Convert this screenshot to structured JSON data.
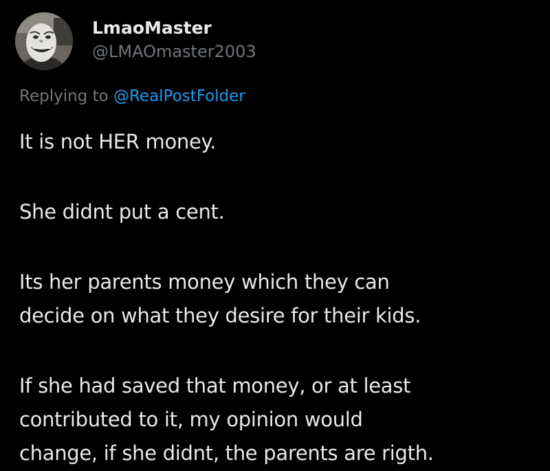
{
  "post": {
    "author": {
      "display_name": "LmaoMaster",
      "handle": "@LMAOmaster2003",
      "avatar_icon": "avatar-troll-mask-icon"
    },
    "replying": {
      "prefix": "Replying to",
      "handle": "@RealPostFolder"
    },
    "body": {
      "line1": "It is not HER money.",
      "line2": "She didnt put a cent.",
      "line3": "Its her parents money which they can",
      "line4": "decide on what they desire for their kids.",
      "line5": "If she had saved that money, or at least",
      "line6": "contributed to it, my opinion would",
      "line7": "change, if she didnt, the parents are rigth."
    }
  },
  "colors": {
    "background": "#000000",
    "primary_text": "#e7e9ea",
    "secondary_text": "#71767b",
    "link": "#1d9bf0"
  }
}
